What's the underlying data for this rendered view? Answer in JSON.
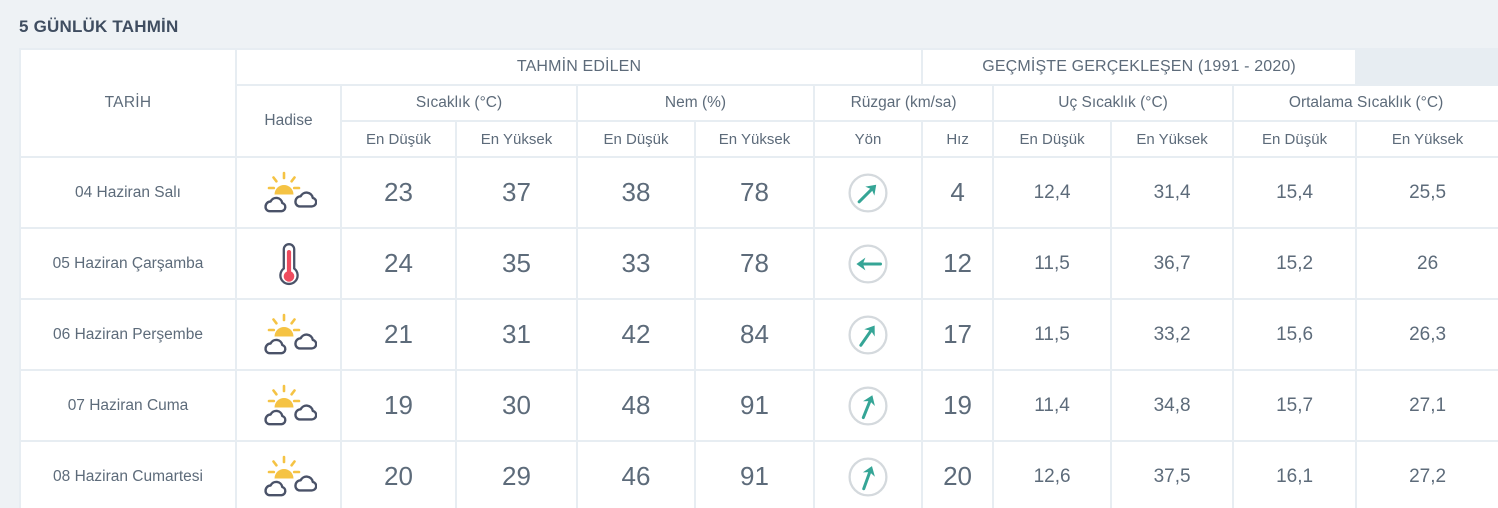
{
  "panel": {
    "title": "5 GÜNLÜK TAHMİN"
  },
  "table": {
    "header": {
      "tarih": "TARİH",
      "hadise": "Hadise",
      "group_forecast": "TAHMİN EDİLEN",
      "group_historical": "GEÇMİŞTE GERÇEKLEŞEN (1991 - 2020)",
      "sub_sicaklik": "Sıcaklık (°C)",
      "sub_nem": "Nem (%)",
      "sub_ruzgar": "Rüzgar (km/sa)",
      "sub_uc_sicaklik": "Uç Sıcaklık (°C)",
      "sub_ortalama_sicaklik": "Ortalama Sıcaklık (°C)",
      "col_en_dusuk": "En Düşük",
      "col_en_yuksek": "En Yüksek",
      "col_yon": "Yön",
      "col_hiz": "Hız"
    },
    "colors": {
      "min_temp": "#3d93b0",
      "max_temp": "#e0566f",
      "min_humidity": "#e0a52e",
      "max_humidity": "#7d7bb5",
      "wind_speed": "#35a596",
      "historical": "#22282e",
      "title": "#3f4d60",
      "page_bg": "#eef2f5",
      "sun": "#f5c344",
      "cloud_outline": "#4a5268",
      "thermometer": "#ee4b5e",
      "dial_ring": "#d4d9dd"
    },
    "rows": [
      {
        "date": "04 Haziran Salı",
        "icon": "sun-behind-clouds-icon",
        "temp_min": "23",
        "temp_max": "37",
        "hum_min": "38",
        "hum_max": "78",
        "wind_dir_icon": "arrow-southwest-icon",
        "wind_dir_deg": 225,
        "wind_speed": "4",
        "hist_extreme_min": "12,4",
        "hist_extreme_max": "31,4",
        "hist_avg_min": "15,4",
        "hist_avg_max": "25,5"
      },
      {
        "date": "05 Haziran Çarşamba",
        "icon": "thermometer-hot-icon",
        "temp_min": "24",
        "temp_max": "35",
        "hum_min": "33",
        "hum_max": "78",
        "wind_dir_icon": "arrow-east-icon",
        "wind_dir_deg": 90,
        "wind_speed": "12",
        "hist_extreme_min": "11,5",
        "hist_extreme_max": "36,7",
        "hist_avg_min": "15,2",
        "hist_avg_max": "26"
      },
      {
        "date": "06 Haziran Perşembe",
        "icon": "sun-behind-clouds-icon",
        "temp_min": "21",
        "temp_max": "31",
        "hum_min": "42",
        "hum_max": "84",
        "wind_dir_icon": "arrow-southwest-icon",
        "wind_dir_deg": 215,
        "wind_speed": "17",
        "hist_extreme_min": "11,5",
        "hist_extreme_max": "33,2",
        "hist_avg_min": "15,6",
        "hist_avg_max": "26,3"
      },
      {
        "date": "07 Haziran Cuma",
        "icon": "sun-behind-clouds-icon",
        "temp_min": "19",
        "temp_max": "30",
        "hum_min": "48",
        "hum_max": "91",
        "wind_dir_icon": "arrow-south-southwest-icon",
        "wind_dir_deg": 202,
        "wind_speed": "19",
        "hist_extreme_min": "11,4",
        "hist_extreme_max": "34,8",
        "hist_avg_min": "15,7",
        "hist_avg_max": "27,1"
      },
      {
        "date": "08 Haziran Cumartesi",
        "icon": "sun-behind-clouds-icon",
        "temp_min": "20",
        "temp_max": "29",
        "hum_min": "46",
        "hum_max": "91",
        "wind_dir_icon": "arrow-south-southwest-icon",
        "wind_dir_deg": 200,
        "wind_speed": "20",
        "hist_extreme_min": "12,6",
        "hist_extreme_max": "37,5",
        "hist_avg_min": "16,1",
        "hist_avg_max": "27,2"
      }
    ]
  }
}
